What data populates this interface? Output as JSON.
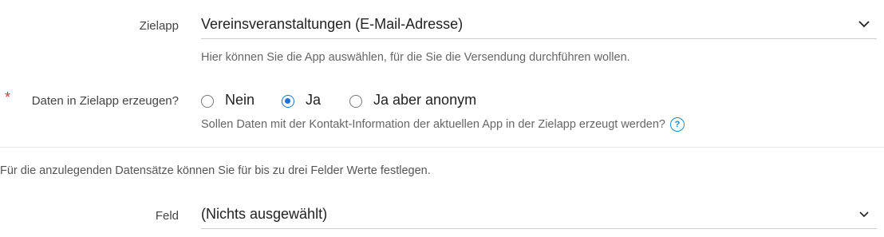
{
  "target_app": {
    "label": "Zielapp",
    "value": "Vereinsveranstaltungen (E-Mail-Adresse)",
    "help": "Hier können Sie die App auswählen, für die Sie die Versendung durchführen wollen."
  },
  "create_data": {
    "required_marker": "*",
    "label": "Daten in Zielapp erzeugen?",
    "options": [
      {
        "label": "Nein",
        "checked": false
      },
      {
        "label": "Ja",
        "checked": true
      },
      {
        "label": "Ja aber anonym",
        "checked": false
      }
    ],
    "help": "Sollen Daten mit der Kontakt-Information der aktuellen App in der Zielapp erzeugt werden?",
    "info_icon": "?"
  },
  "fields_note": "Für die anzulegenden Datensätze können Sie für bis zu drei Felder Werte festlegen.",
  "field": {
    "label": "Feld",
    "value": "(Nichts ausgewählt)"
  },
  "colors": {
    "accent": "#1a73d9",
    "required": "#d9343b",
    "info": "#1a8fd9"
  }
}
